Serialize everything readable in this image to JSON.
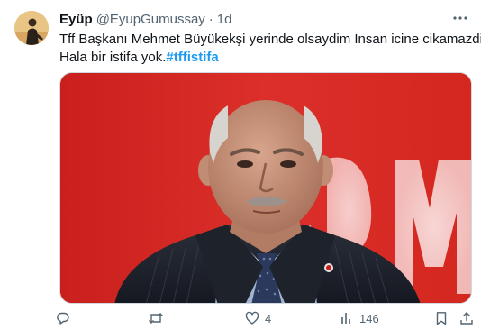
{
  "tweet": {
    "author": {
      "display_name": "Eyüp",
      "handle": "@EyupGumussay",
      "separator": "·",
      "time": "1d"
    },
    "text_line1": "Tff Başkanı Mehmet Büyükekşi yerinde olsaydim Insan icine cikamazdim.",
    "text_line2": "Hala bir istifa yok.",
    "hashtag": "#tffistifa",
    "actions": {
      "reply_count": "",
      "retweet_count": "",
      "like_count": "4",
      "views_count": "146"
    }
  },
  "icons": [
    "more-icon",
    "reply-icon",
    "retweet-icon",
    "like-icon",
    "views-icon",
    "bookmark-icon",
    "share-icon"
  ],
  "colors": {
    "text": "#0f1419",
    "muted": "#536471",
    "link": "#1d9bf0",
    "media_background": "#d72a26"
  }
}
